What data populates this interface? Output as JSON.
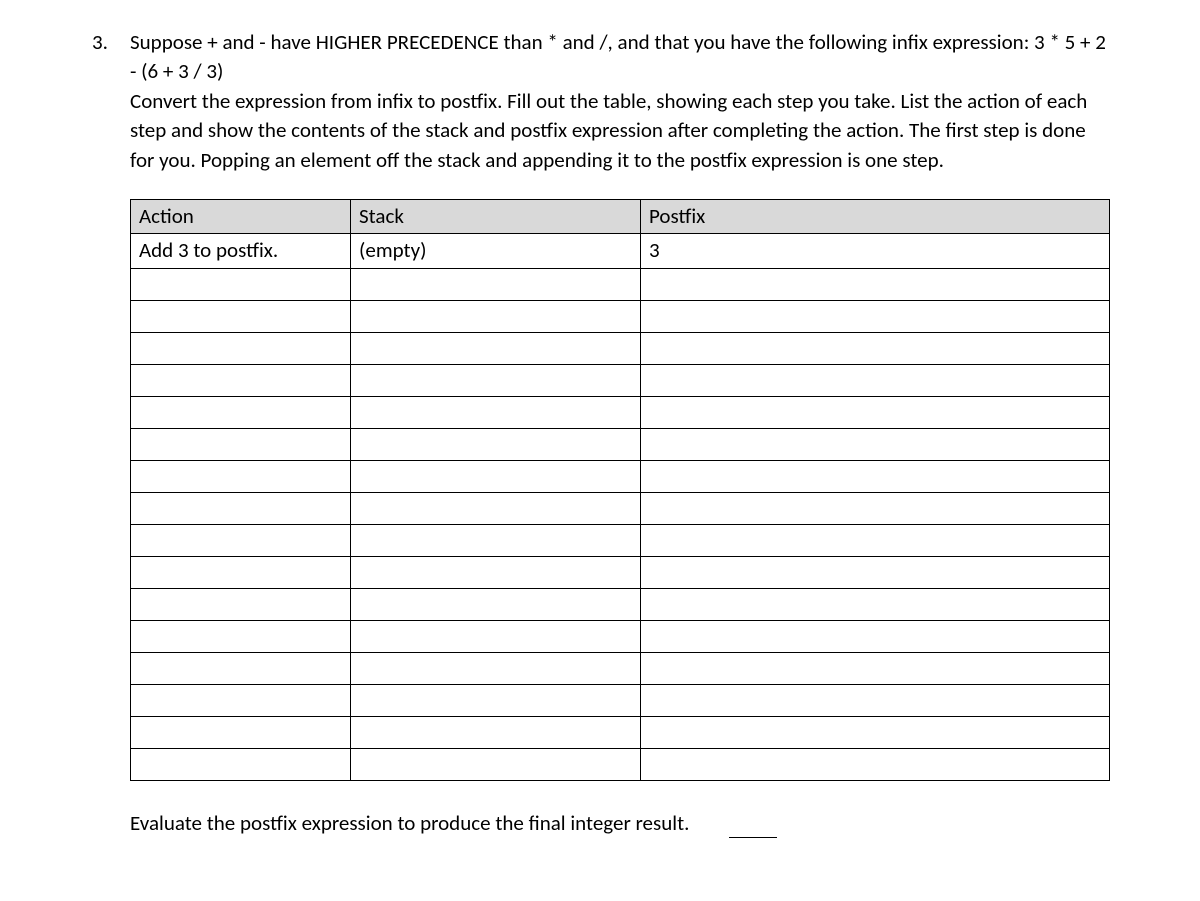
{
  "question": {
    "number": "3.",
    "text": "Suppose + and - have HIGHER PRECEDENCE than * and /, and that you have the following infix expression: 3 * 5 + 2 - (6 + 3 / 3)",
    "instructions": "Convert the expression from infix to postfix. Fill out the table, showing each step you take. List the action of each step and show the contents of the stack and postfix expression after completing the action. The first step is done for you. Popping an element off the stack and appending it to the postfix expression is one step."
  },
  "table": {
    "headers": {
      "action": "Action",
      "stack": "Stack",
      "postfix": "Postfix"
    },
    "rows": [
      {
        "action": "Add 3 to postfix.",
        "stack": "(empty)",
        "postfix": "3"
      },
      {
        "action": "",
        "stack": "",
        "postfix": ""
      },
      {
        "action": "",
        "stack": "",
        "postfix": ""
      },
      {
        "action": "",
        "stack": "",
        "postfix": ""
      },
      {
        "action": "",
        "stack": "",
        "postfix": ""
      },
      {
        "action": "",
        "stack": "",
        "postfix": ""
      },
      {
        "action": "",
        "stack": "",
        "postfix": ""
      },
      {
        "action": "",
        "stack": "",
        "postfix": ""
      },
      {
        "action": "",
        "stack": "",
        "postfix": ""
      },
      {
        "action": "",
        "stack": "",
        "postfix": ""
      },
      {
        "action": "",
        "stack": "",
        "postfix": ""
      },
      {
        "action": "",
        "stack": "",
        "postfix": ""
      },
      {
        "action": "",
        "stack": "",
        "postfix": ""
      },
      {
        "action": "",
        "stack": "",
        "postfix": ""
      },
      {
        "action": "",
        "stack": "",
        "postfix": ""
      },
      {
        "action": "",
        "stack": "",
        "postfix": ""
      },
      {
        "action": "",
        "stack": "",
        "postfix": ""
      }
    ]
  },
  "evaluate": {
    "text": "Evaluate the postfix expression to produce the final integer result."
  }
}
